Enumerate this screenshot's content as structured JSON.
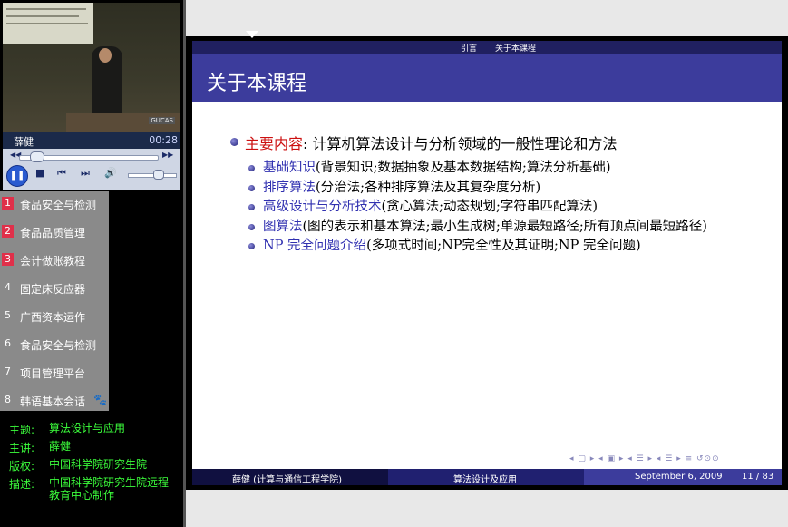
{
  "video": {
    "logo": "GUCAS",
    "speaker": "薛健",
    "time": "00:28"
  },
  "playlist": [
    {
      "num": "1",
      "label": "食品安全与检测",
      "highlight": true
    },
    {
      "num": "2",
      "label": "食品品质管理",
      "highlight": true
    },
    {
      "num": "3",
      "label": "会计做账教程",
      "highlight": true
    },
    {
      "num": "4",
      "label": "固定床反应器",
      "highlight": false
    },
    {
      "num": "5",
      "label": "广西资本运作",
      "highlight": false
    },
    {
      "num": "6",
      "label": "食品安全与检测",
      "highlight": false
    },
    {
      "num": "7",
      "label": "项目管理平台",
      "highlight": false
    },
    {
      "num": "8",
      "label": "韩语基本会话",
      "highlight": false
    }
  ],
  "meta": [
    {
      "key": "主题:",
      "value": "算法设计与应用"
    },
    {
      "key": "主讲:",
      "value": "薛健"
    },
    {
      "key": "版权:",
      "value": "中国科学院研究生院"
    },
    {
      "key": "描述:",
      "value": "中国科学院研究生院远程教育中心制作"
    }
  ],
  "slide": {
    "nav_section": "引言",
    "nav_subsection": "关于本课程",
    "title": "关于本课程",
    "main_keyword": "主要内容",
    "main_text": ": 计算机算法设计与分析领域的一般性理论和方法",
    "items": [
      {
        "kw": "基础知识",
        "text": "(背景知识;数据抽象及基本数据结构;算法分析基础)"
      },
      {
        "kw": "排序算法",
        "text": "(分治法;各种排序算法及其复杂度分析)"
      },
      {
        "kw": "高级设计与分析技术",
        "text": "(贪心算法;动态规划;字符串匹配算法)"
      },
      {
        "kw": "图算法",
        "text": "(图的表示和基本算法;最小生成树;单源最短路径;所有顶点间最短路径)"
      },
      {
        "kw": "NP 完全问题介绍",
        "text": "(多项式时间;NP完全性及其证明;NP 完全问题)"
      }
    ],
    "footer_author": "薛健 (计算与通信工程学院)",
    "footer_course": "算法设计及应用",
    "footer_date": "September 6, 2009",
    "footer_page": "11 / 83"
  }
}
